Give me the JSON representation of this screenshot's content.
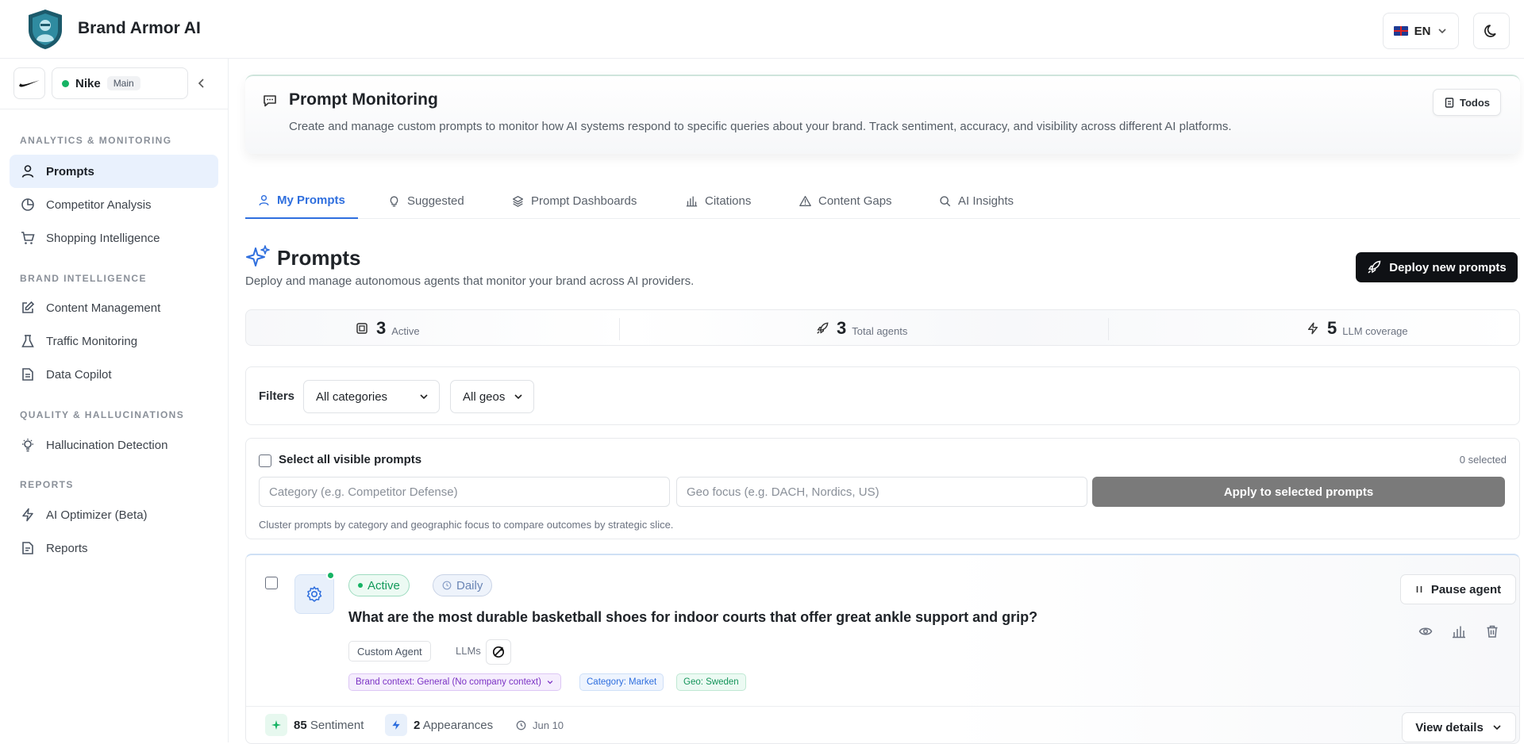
{
  "app": {
    "title": "Brand Armor AI"
  },
  "header": {
    "language": "EN",
    "flag_icon": "uk-flag-icon",
    "theme_icon": "moon-icon"
  },
  "brand": {
    "name": "Nike",
    "tag": "Main"
  },
  "sidebar": {
    "sections": [
      {
        "label": "ANALYTICS & MONITORING"
      },
      {
        "label": "BRAND INTELLIGENCE"
      },
      {
        "label": "QUALITY & HALLUCINATIONS"
      },
      {
        "label": "REPORTS"
      }
    ],
    "items": [
      {
        "label": "Prompts",
        "icon": "user-icon",
        "active": true
      },
      {
        "label": "Competitor Analysis",
        "icon": "pie-chart-icon"
      },
      {
        "label": "Shopping Intelligence",
        "icon": "cart-icon"
      },
      {
        "label": "Content Management",
        "icon": "edit-icon"
      },
      {
        "label": "Traffic Monitoring",
        "icon": "flask-icon"
      },
      {
        "label": "Data Copilot",
        "icon": "file-text-icon"
      },
      {
        "label": "Hallucination Detection",
        "icon": "lightbulb-icon"
      },
      {
        "label": "AI Optimizer (Beta)",
        "icon": "zap-icon"
      },
      {
        "label": "Reports",
        "icon": "file-icon"
      }
    ]
  },
  "hero": {
    "title": "Prompt Monitoring",
    "description": "Create and manage custom prompts to monitor how AI systems respond to specific queries about your brand. Track sentiment, accuracy, and visibility across different AI platforms.",
    "todos_label": "Todos"
  },
  "tabs": [
    {
      "label": "My Prompts",
      "icon": "user-icon",
      "active": true
    },
    {
      "label": "Suggested",
      "icon": "lightbulb-icon"
    },
    {
      "label": "Prompt Dashboards",
      "icon": "layers-icon"
    },
    {
      "label": "Citations",
      "icon": "bar-chart-icon"
    },
    {
      "label": "Content Gaps",
      "icon": "warning-icon"
    },
    {
      "label": "AI Insights",
      "icon": "search-icon"
    }
  ],
  "prompts_section": {
    "title": "Prompts",
    "description": "Deploy and manage autonomous agents that monitor your brand across AI providers.",
    "deploy_label": "Deploy new prompts"
  },
  "stats": [
    {
      "value": "3",
      "label": "Active",
      "icon": "chip-icon"
    },
    {
      "value": "3",
      "label": "Total agents",
      "icon": "rocket-icon"
    },
    {
      "value": "5",
      "label": "LLM coverage",
      "icon": "zap-icon"
    }
  ],
  "filters": {
    "label": "Filters",
    "category_value": "All categories",
    "geo_value": "All geos"
  },
  "bulk": {
    "select_all_label": "Select all visible prompts",
    "selected_count": "0 selected",
    "category_placeholder": "Category (e.g. Competitor Defense)",
    "geo_placeholder": "Geo focus (e.g. DACH, Nordics, US)",
    "apply_label": "Apply to selected prompts",
    "hint": "Cluster prompts by category and geographic focus to compare outcomes by strategic slice."
  },
  "prompt_card": {
    "status": "Active",
    "frequency": "Daily",
    "question": "What are the most durable basketball shoes for indoor courts that offer great ankle support and grip?",
    "agent_type": "Custom Agent",
    "llms_label": "LLMs",
    "brand_context": "Brand context: General (No company context)",
    "category": "Category: Market",
    "geo": "Geo: Sweden",
    "pause_label": "Pause agent",
    "sentiment_value": "85",
    "sentiment_label": "Sentiment",
    "appearances_value": "2",
    "appearances_label": "Appearances",
    "date": "Jun 10",
    "view_label": "View details"
  },
  "colors": {
    "accent": "#2f6fde",
    "active_green": "#16b364",
    "primary_button": "#0f1115"
  }
}
